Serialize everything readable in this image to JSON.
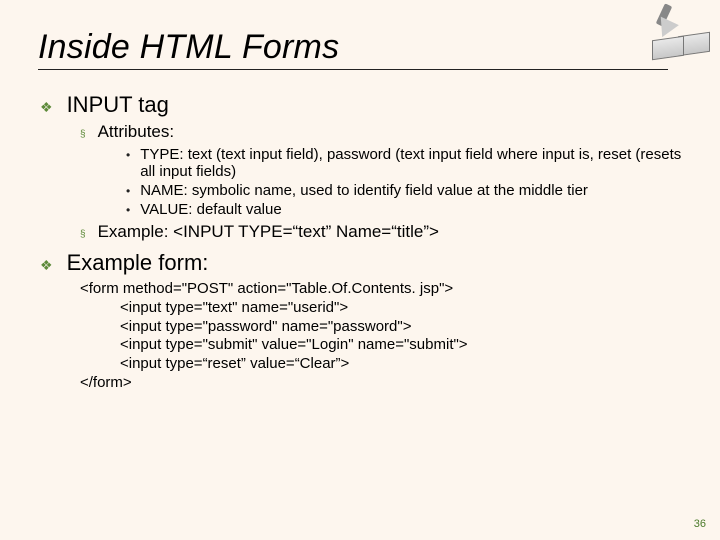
{
  "title": "Inside HTML Forms",
  "page_number": "36",
  "sections": [
    {
      "label": "INPUT tag",
      "sub": [
        {
          "label": "Attributes:",
          "items": [
            "TYPE: text (text input field), password (text input field where input is, reset (resets all input fields)",
            "NAME: symbolic name, used to identify field value at the middle tier",
            "VALUE: default value"
          ]
        },
        {
          "label": "Example: <INPUT TYPE=“text” Name=“title”>"
        }
      ]
    },
    {
      "label": "Example form:",
      "code": [
        "<form method=\"POST\" action=\"Table.Of.Contents. jsp\">",
        "<input type=\"text\" name=\"userid\">",
        "<input type=\"password\" name=\"password\">",
        "<input type=\"submit\" value=\"Login\" name=\"submit\">",
        "<input type=“reset” value=“Clear”>",
        "</form>"
      ]
    }
  ]
}
